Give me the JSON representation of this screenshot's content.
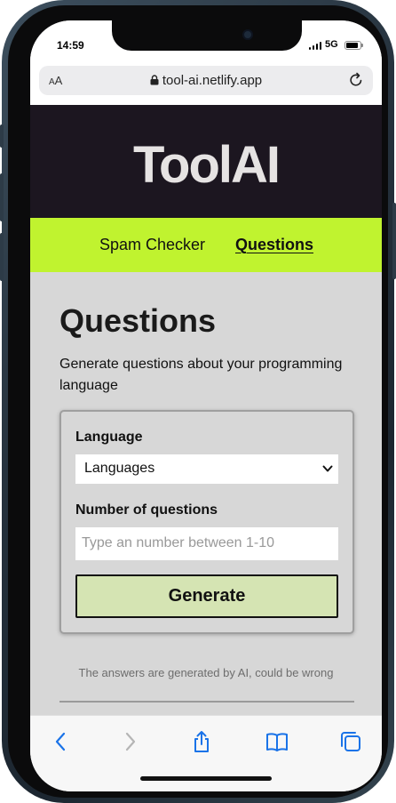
{
  "status_bar": {
    "time": "14:59",
    "network": "5G"
  },
  "browser": {
    "text_size_label_small": "A",
    "text_size_label_large": "A",
    "url": "tool-ai.netlify.app"
  },
  "site": {
    "logo": "ToolAI"
  },
  "nav": {
    "items": [
      {
        "label": "Spam Checker",
        "active": false
      },
      {
        "label": "Questions",
        "active": true
      }
    ]
  },
  "page": {
    "title": "Questions",
    "description": "Generate questions about your programming language",
    "form": {
      "language_label": "Language",
      "language_selected": "Languages",
      "count_label": "Number of questions",
      "count_placeholder": "Type an number between 1-10",
      "count_value": "",
      "generate_label": "Generate"
    },
    "disclaimer": "The answers are generated by AI, could be wrong"
  },
  "toolbar": {
    "icons": [
      "back-icon",
      "forward-icon",
      "share-icon",
      "bookmarks-icon",
      "tabs-icon"
    ]
  },
  "colors": {
    "header_bg": "#1c1620",
    "nav_bg": "#c0f32f",
    "main_bg": "#d7d7d7",
    "button_bg": "#d5e4b3",
    "accent_blue": "#1a73e8"
  }
}
